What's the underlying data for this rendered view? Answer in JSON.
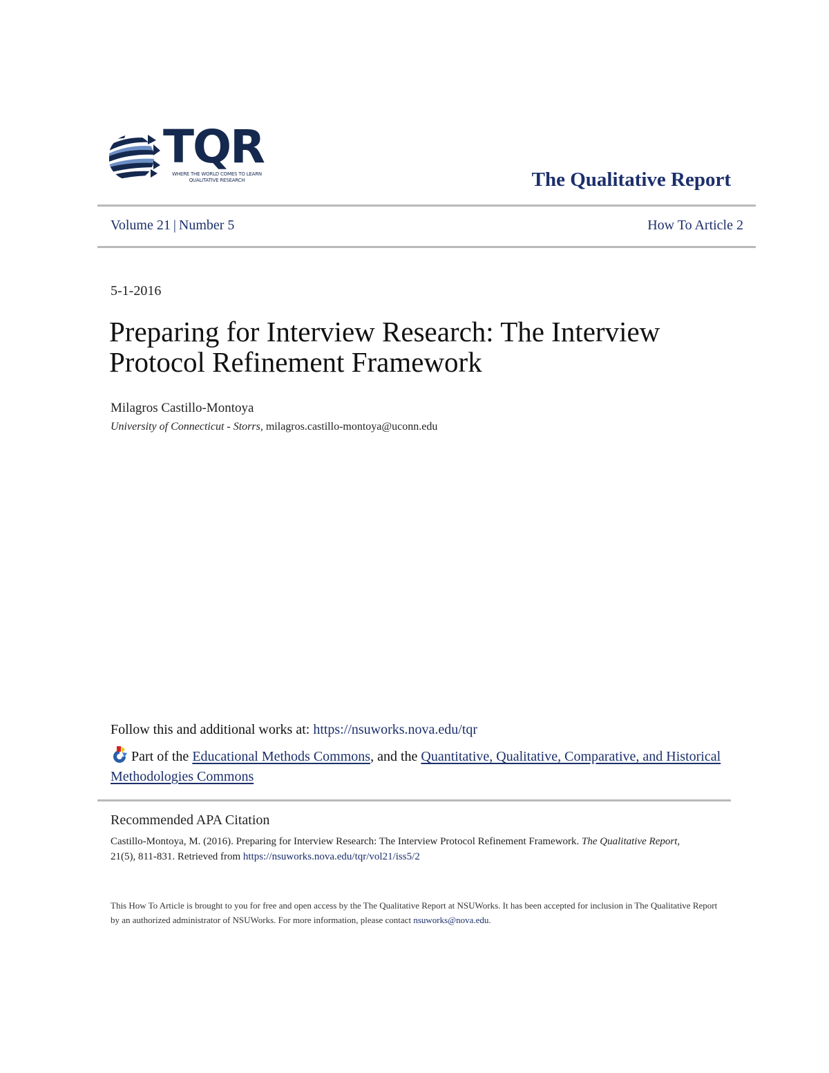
{
  "header": {
    "logo": {
      "letters": "TQR",
      "tagline_line1": "WHERE THE WORLD COMES TO LEARN",
      "tagline_line2": "QUALITATIVE RESEARCH",
      "icon": "globe-arrows-icon"
    },
    "journal_title": "The Qualitative Report",
    "volume": "Volume 21",
    "separator": "|",
    "number": "Number 5",
    "article_type": "How To Article 2"
  },
  "article": {
    "date": "5-1-2016",
    "title": "Preparing for Interview Research: The Interview Protocol Refinement Framework",
    "author": "Milagros Castillo-Montoya",
    "affiliation_italic": "University of Connecticut - Storrs",
    "affiliation_rest": ", milagros.castillo-montoya@uconn.edu"
  },
  "links": {
    "follow_prefix": "Follow this and additional works at: ",
    "follow_url": "https://nsuworks.nova.edu/tqr",
    "part_prefix": "Part of the ",
    "commons_1": "Educational Methods Commons",
    "part_middle": ", and the ",
    "commons_2": "Quantitative, Qualitative, Comparative, and Historical Methodologies Commons",
    "bepress_icon": "bepress-commons-icon"
  },
  "citation": {
    "heading": "Recommended APA Citation",
    "text_before": "Castillo-Montoya, M. (2016). Preparing for Interview Research: The Interview Protocol Refinement Framework. ",
    "journal_italic": "The Qualitative Report",
    "text_after": ", 21(5), 811-831. Retrieved from ",
    "url": "https://nsuworks.nova.edu/tqr/vol21/iss5/2"
  },
  "footer": {
    "text_before": "This How To Article is brought to you for free and open access by the The Qualitative Report at NSUWorks. It has been accepted for inclusion in The Qualitative Report by an authorized administrator of NSUWorks. For more information, please contact ",
    "email": "nsuworks@nova.edu",
    "text_after": "."
  },
  "colors": {
    "brand_navy": "#15294f",
    "link_blue": "#1c2f6b",
    "rule_gray": "#b9b9b9",
    "globe_light": "#6c8fc4"
  }
}
